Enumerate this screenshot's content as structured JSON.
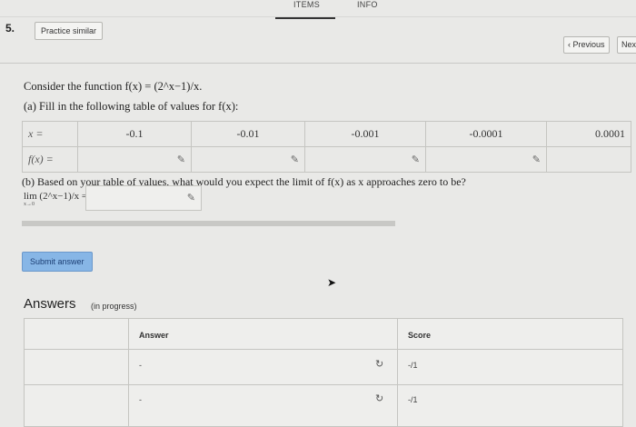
{
  "tabs": [
    {
      "label": "ITEMS",
      "active": true
    },
    {
      "label": "INFO",
      "active": false
    }
  ],
  "question": {
    "number": "5.",
    "practice_button": "Practice similar",
    "prev_button": "‹ Previous",
    "next_button": "Next"
  },
  "problem": {
    "intro_text": "Consider the function f(x) = (2^x−1)/x.",
    "part_a": "(a) Fill in the following table of values for f(x):",
    "table": {
      "x_label": "x =",
      "fx_label": "f(x) =",
      "x_values": [
        "-0.1",
        "-0.01",
        "-0.001",
        "-0.0001",
        "0.0001"
      ]
    },
    "part_b": "(b) Based on your table of values, what would you expect the limit of f(x) as x approaches zero to be?",
    "limit_label": "lim (2^x−1)/x =",
    "limit_sub": "x→0"
  },
  "actions": {
    "submit": "Submit answer"
  },
  "answers": {
    "title": "Answers",
    "status": "(in progress)",
    "headers": {
      "answer": "Answer",
      "score": "Score"
    },
    "rows": [
      {
        "answer": "-",
        "score": "-/1"
      },
      {
        "answer": "-",
        "score": "-/1"
      }
    ]
  },
  "colors": {
    "background": "#e9e9e7",
    "submit_button": "#87b6e6",
    "border": "#c5c5c1"
  },
  "icons": [
    "pencil-icon",
    "refresh-icon",
    "pointer-cursor-icon"
  ]
}
